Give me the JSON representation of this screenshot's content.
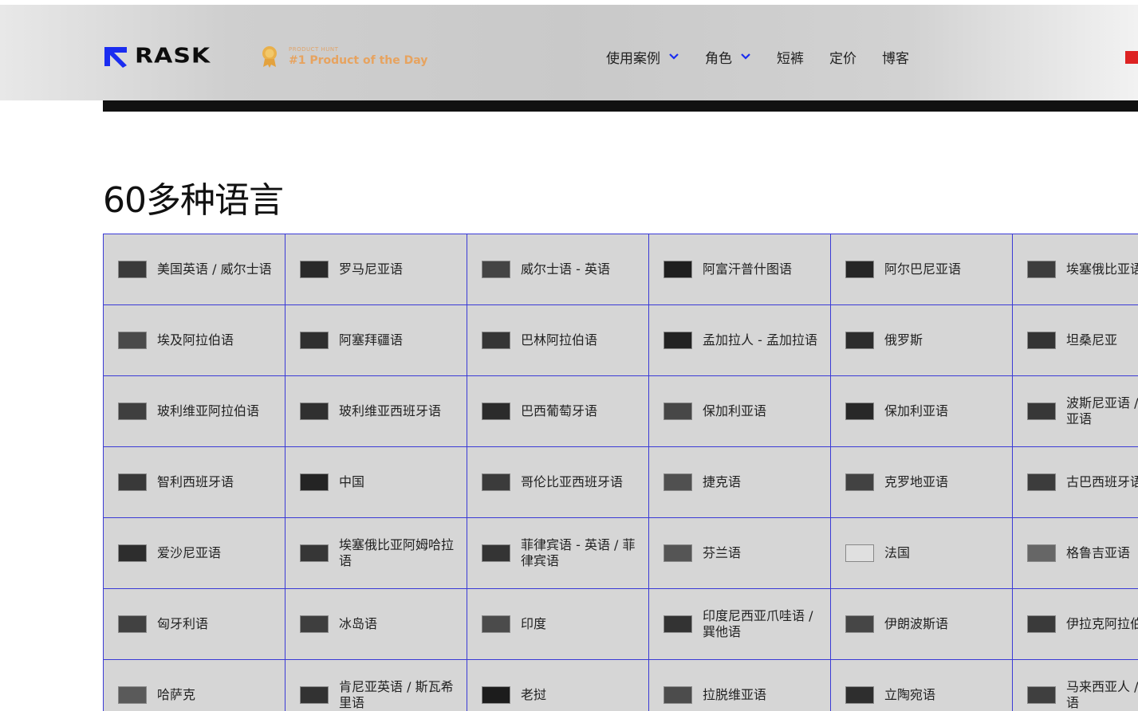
{
  "header": {
    "logo_text": "RASK",
    "badge_sup": "PRODUCT HUNT",
    "badge_main": "#1 Product of the Day",
    "nav": [
      {
        "label": "使用案例",
        "dropdown": true
      },
      {
        "label": "角色",
        "dropdown": true
      },
      {
        "label": "短裤",
        "dropdown": false
      },
      {
        "label": "定价",
        "dropdown": false
      },
      {
        "label": "博客",
        "dropdown": false
      }
    ]
  },
  "page_title": "60多种语言",
  "languages": [
    [
      "美国英语 / 威尔士语",
      "罗马尼亚语",
      "威尔士语 - 英语",
      "阿富汗普什图语",
      "阿尔巴尼亚语",
      "埃塞俄比亚语"
    ],
    [
      "埃及阿拉伯语",
      "阿塞拜疆语",
      "巴林阿拉伯语",
      "孟加拉人 - 孟加拉语",
      "俄罗斯",
      "坦桑尼亚"
    ],
    [
      "玻利维亚阿拉伯语",
      "玻利维亚西班牙语",
      "巴西葡萄牙语",
      "保加利亚语",
      "保加利亚语",
      "波斯尼亚语 / 塞尔维亚语"
    ],
    [
      "智利西班牙语",
      "中国",
      "哥伦比亚西班牙语",
      "捷克语",
      "克罗地亚语",
      "古巴西班牙语"
    ],
    [
      "爱沙尼亚语",
      "埃塞俄比亚阿姆哈拉语",
      "菲律宾语 - 英语 / 菲律宾语",
      "芬兰语",
      "法国",
      "格鲁吉亚语"
    ],
    [
      "匈牙利语",
      "冰岛语",
      "印度",
      "印度尼西亚爪哇语 / 巽他语",
      "伊朗波斯语",
      "伊拉克阿拉伯语"
    ],
    [
      "哈萨克",
      "肯尼亚英语 / 斯瓦希里语",
      "老挝",
      "拉脱维亚语",
      "立陶宛语",
      "马来西亚人 / 泰米尔语"
    ]
  ],
  "flag_colors": [
    [
      "#3a3a3a",
      "#2a2a2a",
      "#444444",
      "#1f1f1f",
      "#262626",
      "#3d3d3d"
    ],
    [
      "#4a4a4a",
      "#2f2f2f",
      "#353535",
      "#222222",
      "#2c2c2c",
      "#333333"
    ],
    [
      "#3f3f3f",
      "#303030",
      "#2b2b2b",
      "#474747",
      "#282828",
      "#373737"
    ],
    [
      "#393939",
      "#242424",
      "#3b3b3b",
      "#505050",
      "#424242",
      "#3c3c3c"
    ],
    [
      "#2d2d2d",
      "#363636",
      "#343434",
      "#555555",
      "#e0e0e0",
      "#666666"
    ],
    [
      "#414141",
      "#3e3e3e",
      "#4b4b4b",
      "#333333",
      "#464646",
      "#3a3a3a"
    ],
    [
      "#5a5a5a",
      "#323232",
      "#1c1c1c",
      "#4c4c4c",
      "#2e2e2e",
      "#3f3f3f"
    ]
  ],
  "colors": {
    "grid_border": "#3a3ad6",
    "cell_bg": "#d6d6d6",
    "logo_blue": "#1a2cf0",
    "badge_orange": "#e7a35f"
  }
}
